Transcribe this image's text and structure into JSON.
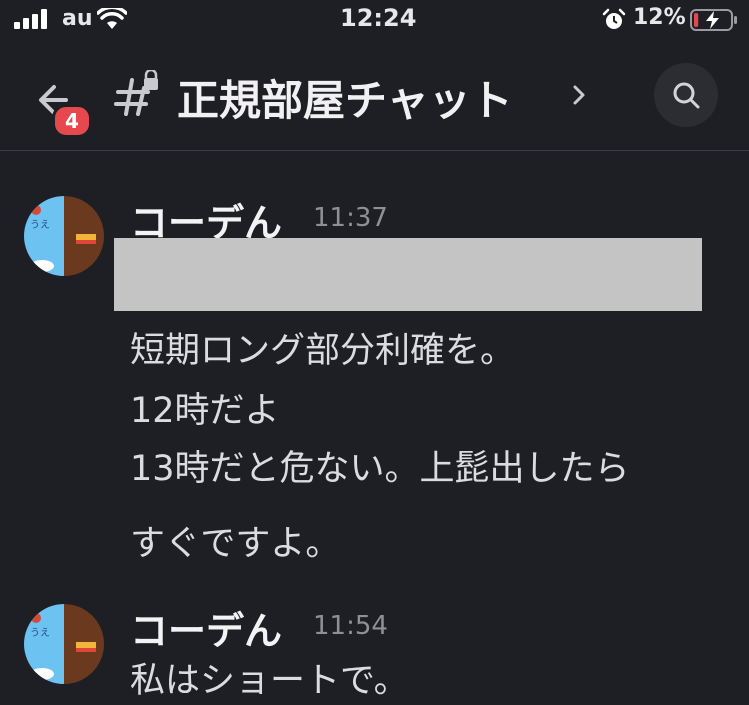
{
  "status_bar": {
    "carrier": "au",
    "time": "12:24",
    "battery_percent": "12%",
    "battery_level": 0.12,
    "charging": true
  },
  "header": {
    "back_badge_count": "4",
    "channel_title": "正規部屋チャット"
  },
  "messages": [
    {
      "author": "コーデん",
      "time": "11:37",
      "redacted": true,
      "lines": [
        "短期ロング部分利確を。",
        "12時だよ",
        "13時だと危ない。上髭出したら",
        "すぐですよ。"
      ]
    },
    {
      "author": "コーデん",
      "time": "11:54",
      "lines": [
        "私はショートで。"
      ]
    }
  ],
  "colors": {
    "background": "#1e1f24",
    "badge": "#e5484d",
    "text": "#dcdce0",
    "muted": "#8e9096",
    "battery_low": "#e5484d"
  },
  "icons": [
    "signal-icon",
    "wifi-icon",
    "alarm-icon",
    "battery-icon",
    "back-arrow-icon",
    "private-channel-icon",
    "chevron-right-icon",
    "search-icon"
  ]
}
